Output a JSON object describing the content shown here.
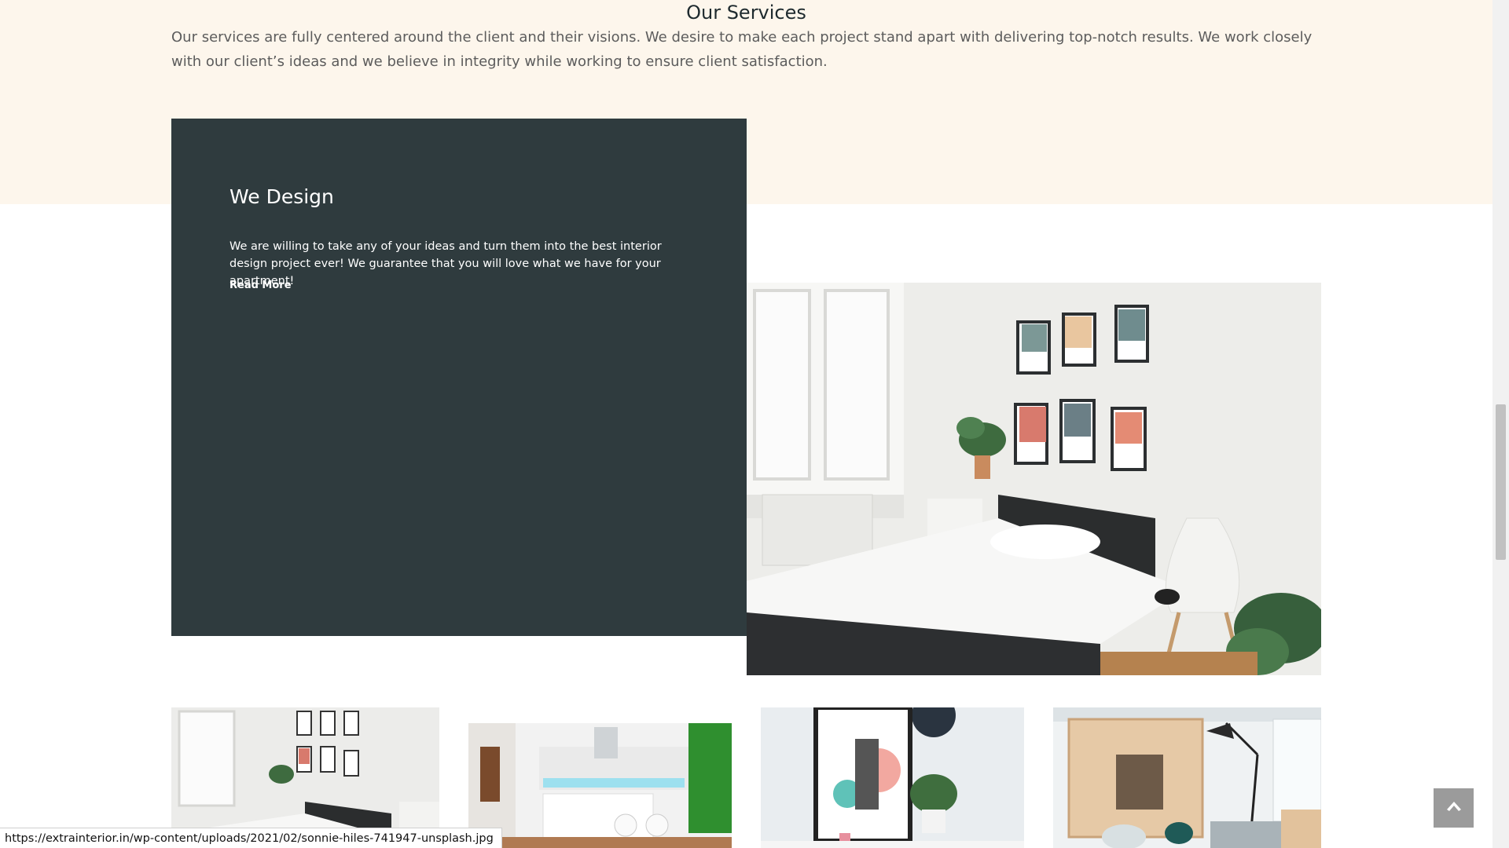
{
  "services": {
    "title": "Our Services",
    "intro": "Our services are fully centered around the client and their visions. We desire to make each project stand apart with delivering top-notch results. We work closely with our client’s ideas and we believe in integrity while working to ensure client satisfaction."
  },
  "design_card": {
    "title": "We Design",
    "text": "We are willing to take any of your ideas and turn them into the best interior design project ever! We guarantee that you will love what we have for your apartment!",
    "read_more": "Read More"
  },
  "colors": {
    "band_background": "#fdf6ec",
    "card_background": "#2f3b3e",
    "back_to_top": "#9b9b9b"
  },
  "icons": {
    "back_to_top": "chevron-up-icon"
  },
  "status_bar": {
    "url": "https://extrainterior.in/wp-content/uploads/2021/02/sonnie-hiles-741947-unsplash.jpg"
  }
}
